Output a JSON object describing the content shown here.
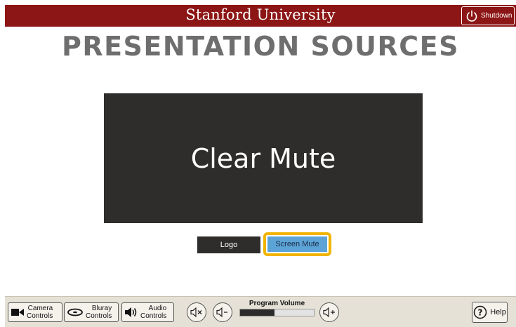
{
  "header": {
    "title": "Stanford University",
    "shutdown_label": "Shutdown",
    "brand_color": "#8c1515"
  },
  "main": {
    "title": "PRESENTATION SOURCES",
    "preview_label": "Clear Mute",
    "sources": [
      {
        "label": "Logo",
        "selected": false
      },
      {
        "label": "Screen Mute",
        "selected": true
      }
    ],
    "selected_highlight_color": "#f1b400"
  },
  "footer": {
    "camera": {
      "line1": "Camera",
      "line2": "Controls",
      "icon": "video-camera-icon"
    },
    "bluray": {
      "line1": "Bluray",
      "line2": "Controls",
      "icon": "bluray-disc-icon"
    },
    "audio": {
      "line1": "Audio",
      "line2": "Controls",
      "icon": "speaker-icon"
    },
    "volume": {
      "label": "Program Volume",
      "level_fraction": 0.47,
      "mute_icon": "speaker-mute-icon",
      "down_icon": "speaker-minus-icon",
      "up_icon": "speaker-plus-icon"
    },
    "help_label": "Help"
  }
}
